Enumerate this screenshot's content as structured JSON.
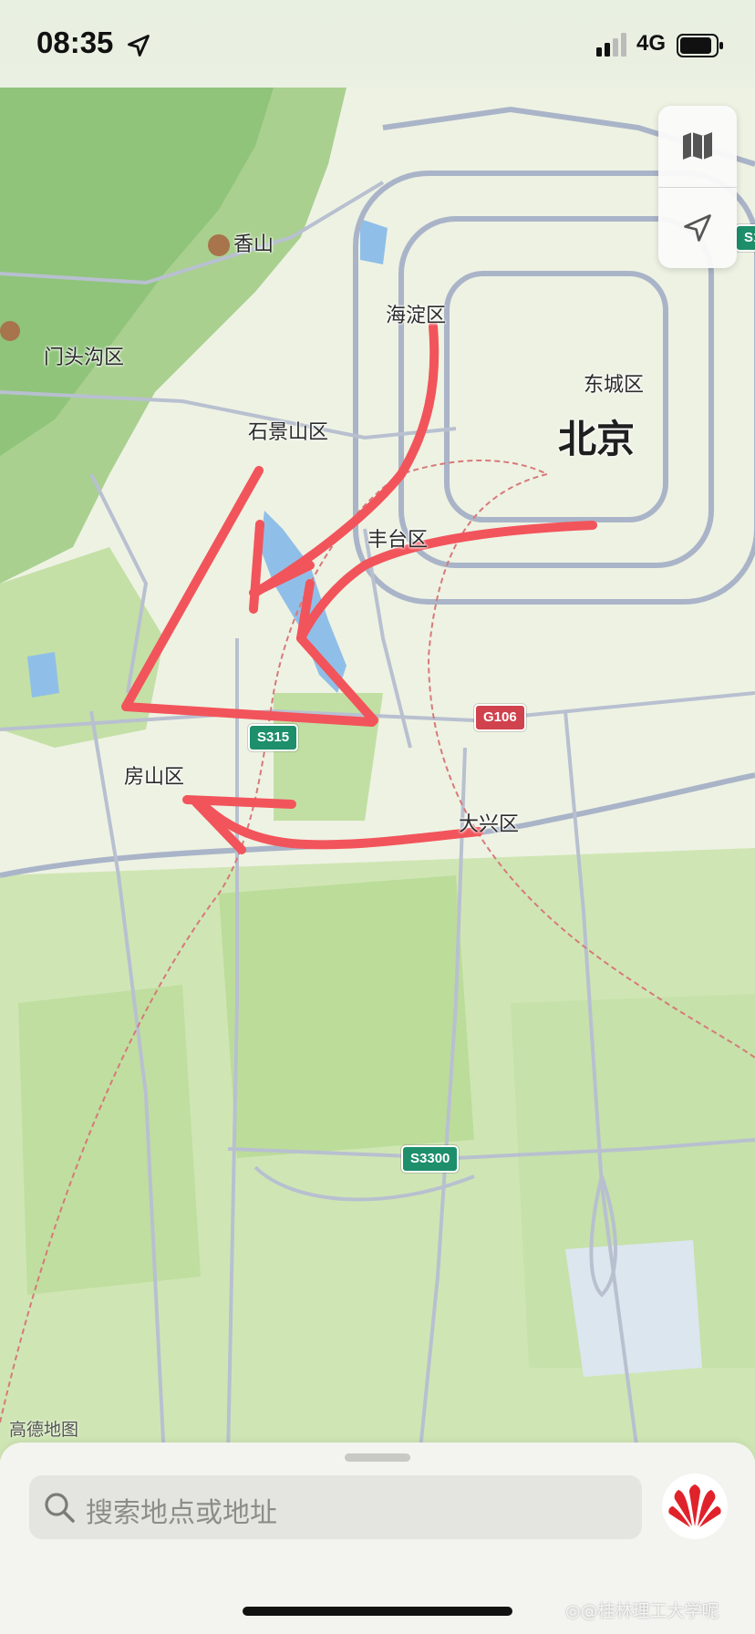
{
  "status_bar": {
    "time": "08:35",
    "network": "4G",
    "icons": [
      "location-arrow-icon",
      "signal-icon",
      "battery-icon"
    ]
  },
  "map_controls": {
    "icons": [
      "map-mode-icon",
      "locate-me-icon"
    ]
  },
  "map": {
    "labels": {
      "xiangshan": "香山",
      "mentougou": "门头沟区",
      "haidian": "海淀区",
      "dongcheng": "东城区",
      "beijing": "北京",
      "shijingshan": "石景山区",
      "fengtai": "丰台区",
      "fangshan": "房山区",
      "daxing": "大兴区"
    },
    "shields": {
      "s315": "S315",
      "g106": "G106",
      "s3300": "S3300",
      "s1_partial": "S1"
    },
    "annotation_color": "#f2545b",
    "attribution": "高德地图"
  },
  "bottom_sheet": {
    "search_placeholder": "搜索地点或地址",
    "watermark": "◎@桂林理工大学呢"
  }
}
